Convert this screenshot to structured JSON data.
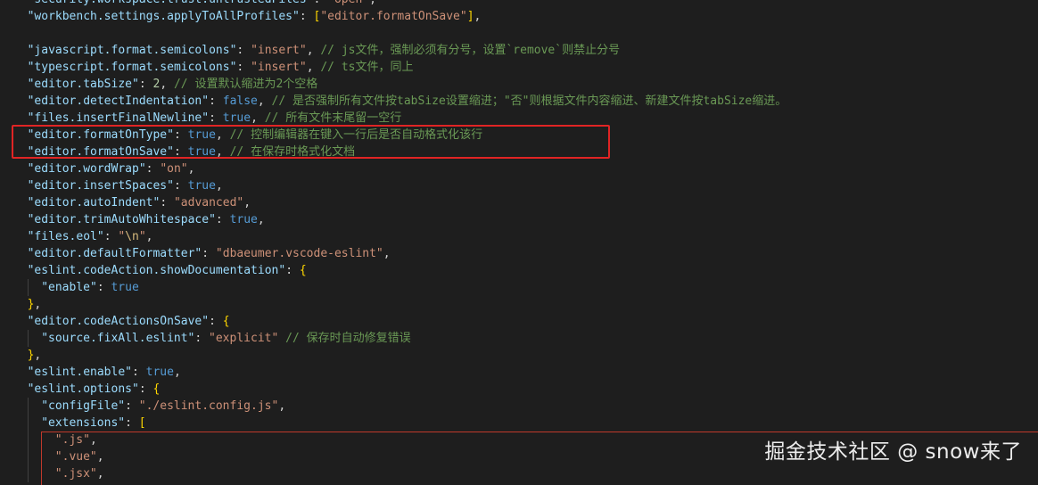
{
  "editor": {
    "lines": [
      {
        "indent": 1,
        "segs": [
          [
            "k",
            "\"security.workspace.trust.untrustedFiles\""
          ],
          [
            "p",
            ": "
          ],
          [
            "s",
            "\"open\""
          ],
          [
            "p",
            ","
          ]
        ]
      },
      {
        "indent": 1,
        "segs": [
          [
            "k",
            "\"workbench.settings.applyToAllProfiles\""
          ],
          [
            "p",
            ": "
          ],
          [
            "y",
            "["
          ],
          [
            "s",
            "\"editor.formatOnSave\""
          ],
          [
            "y",
            "]"
          ],
          [
            "p",
            ","
          ]
        ]
      },
      {
        "indent": 0,
        "segs": []
      },
      {
        "indent": 1,
        "segs": [
          [
            "k",
            "\"javascript.format.semicolons\""
          ],
          [
            "p",
            ": "
          ],
          [
            "s",
            "\"insert\""
          ],
          [
            "p",
            ", "
          ],
          [
            "c",
            "// js文件，强制必须有分号，设置`remove`则禁止分号"
          ]
        ]
      },
      {
        "indent": 1,
        "segs": [
          [
            "k",
            "\"typescript.format.semicolons\""
          ],
          [
            "p",
            ": "
          ],
          [
            "s",
            "\"insert\""
          ],
          [
            "p",
            ", "
          ],
          [
            "c",
            "// ts文件，同上"
          ]
        ]
      },
      {
        "indent": 1,
        "segs": [
          [
            "k",
            "\"editor.tabSize\""
          ],
          [
            "p",
            ": "
          ],
          [
            "n",
            "2"
          ],
          [
            "p",
            ", "
          ],
          [
            "c",
            "// 设置默认缩进为2个空格"
          ]
        ]
      },
      {
        "indent": 1,
        "segs": [
          [
            "k",
            "\"editor.detectIndentation\""
          ],
          [
            "p",
            ": "
          ],
          [
            "b",
            "false"
          ],
          [
            "p",
            ", "
          ],
          [
            "c",
            "// 是否强制所有文件按tabSize设置缩进；\"否\"则根据文件内容缩进、新建文件按tabSize缩进。"
          ]
        ]
      },
      {
        "indent": 1,
        "segs": [
          [
            "k",
            "\"files.insertFinalNewline\""
          ],
          [
            "p",
            ": "
          ],
          [
            "b",
            "true"
          ],
          [
            "p",
            ", "
          ],
          [
            "c",
            "// 所有文件末尾留一空行"
          ]
        ]
      },
      {
        "indent": 1,
        "segs": [
          [
            "k",
            "\"editor.formatOnType\""
          ],
          [
            "p",
            ": "
          ],
          [
            "b",
            "true"
          ],
          [
            "p",
            ", "
          ],
          [
            "c",
            "// 控制编辑器在键入一行后是否自动格式化该行"
          ]
        ]
      },
      {
        "indent": 1,
        "segs": [
          [
            "k",
            "\"editor.formatOnSave\""
          ],
          [
            "p",
            ": "
          ],
          [
            "b",
            "true"
          ],
          [
            "p",
            ", "
          ],
          [
            "c",
            "// 在保存时格式化文档"
          ]
        ]
      },
      {
        "indent": 1,
        "segs": [
          [
            "k",
            "\"editor.wordWrap\""
          ],
          [
            "p",
            ": "
          ],
          [
            "s",
            "\"on\""
          ],
          [
            "p",
            ","
          ]
        ]
      },
      {
        "indent": 1,
        "segs": [
          [
            "k",
            "\"editor.insertSpaces\""
          ],
          [
            "p",
            ": "
          ],
          [
            "b",
            "true"
          ],
          [
            "p",
            ","
          ]
        ]
      },
      {
        "indent": 1,
        "segs": [
          [
            "k",
            "\"editor.autoIndent\""
          ],
          [
            "p",
            ": "
          ],
          [
            "s",
            "\"advanced\""
          ],
          [
            "p",
            ","
          ]
        ]
      },
      {
        "indent": 1,
        "segs": [
          [
            "k",
            "\"editor.trimAutoWhitespace\""
          ],
          [
            "p",
            ": "
          ],
          [
            "b",
            "true"
          ],
          [
            "p",
            ","
          ]
        ]
      },
      {
        "indent": 1,
        "segs": [
          [
            "k",
            "\"files.eol\""
          ],
          [
            "p",
            ": "
          ],
          [
            "s",
            "\""
          ],
          [
            "e",
            "\\n"
          ],
          [
            "s",
            "\""
          ],
          [
            "p",
            ","
          ]
        ]
      },
      {
        "indent": 1,
        "segs": [
          [
            "k",
            "\"editor.defaultFormatter\""
          ],
          [
            "p",
            ": "
          ],
          [
            "s",
            "\"dbaeumer.vscode-eslint\""
          ],
          [
            "p",
            ","
          ]
        ]
      },
      {
        "indent": 1,
        "segs": [
          [
            "k",
            "\"eslint.codeAction.showDocumentation\""
          ],
          [
            "p",
            ": "
          ],
          [
            "y",
            "{"
          ]
        ]
      },
      {
        "indent": 2,
        "segs": [
          [
            "k",
            "\"enable\""
          ],
          [
            "p",
            ": "
          ],
          [
            "b",
            "true"
          ]
        ]
      },
      {
        "indent": 1,
        "segs": [
          [
            "y",
            "}"
          ],
          [
            "p",
            ","
          ]
        ]
      },
      {
        "indent": 1,
        "segs": [
          [
            "k",
            "\"editor.codeActionsOnSave\""
          ],
          [
            "p",
            ": "
          ],
          [
            "y",
            "{"
          ]
        ]
      },
      {
        "indent": 2,
        "segs": [
          [
            "k",
            "\"source.fixAll.eslint\""
          ],
          [
            "p",
            ": "
          ],
          [
            "s",
            "\"explicit\""
          ],
          [
            "p",
            " "
          ],
          [
            "c",
            "// 保存时自动修复错误"
          ]
        ]
      },
      {
        "indent": 1,
        "segs": [
          [
            "y",
            "}"
          ],
          [
            "p",
            ","
          ]
        ]
      },
      {
        "indent": 1,
        "segs": [
          [
            "k",
            "\"eslint.enable\""
          ],
          [
            "p",
            ": "
          ],
          [
            "b",
            "true"
          ],
          [
            "p",
            ","
          ]
        ]
      },
      {
        "indent": 1,
        "segs": [
          [
            "k",
            "\"eslint.options\""
          ],
          [
            "p",
            ": "
          ],
          [
            "y",
            "{"
          ]
        ]
      },
      {
        "indent": 2,
        "segs": [
          [
            "k",
            "\"configFile\""
          ],
          [
            "p",
            ": "
          ],
          [
            "s",
            "\"./eslint.config.js\""
          ],
          [
            "p",
            ","
          ]
        ]
      },
      {
        "indent": 2,
        "segs": [
          [
            "k",
            "\"extensions\""
          ],
          [
            "p",
            ": "
          ],
          [
            "y",
            "["
          ]
        ]
      },
      {
        "indent": 3,
        "segs": [
          [
            "s",
            "\".js\""
          ],
          [
            "p",
            ","
          ]
        ]
      },
      {
        "indent": 3,
        "segs": [
          [
            "s",
            "\".vue\""
          ],
          [
            "p",
            ","
          ]
        ]
      },
      {
        "indent": 3,
        "segs": [
          [
            "s",
            "\".jsx\""
          ],
          [
            "p",
            ","
          ]
        ]
      }
    ]
  },
  "colors": {
    "background": "#1e1e1e",
    "property_key": "#9cdcfe",
    "string": "#ce9178",
    "boolean": "#569cd6",
    "number": "#b5cea8",
    "comment": "#6a9955",
    "bracket": "#ffd700",
    "highlight_box": "#e02424"
  },
  "watermark": "掘金技术社区 @ snow来了"
}
